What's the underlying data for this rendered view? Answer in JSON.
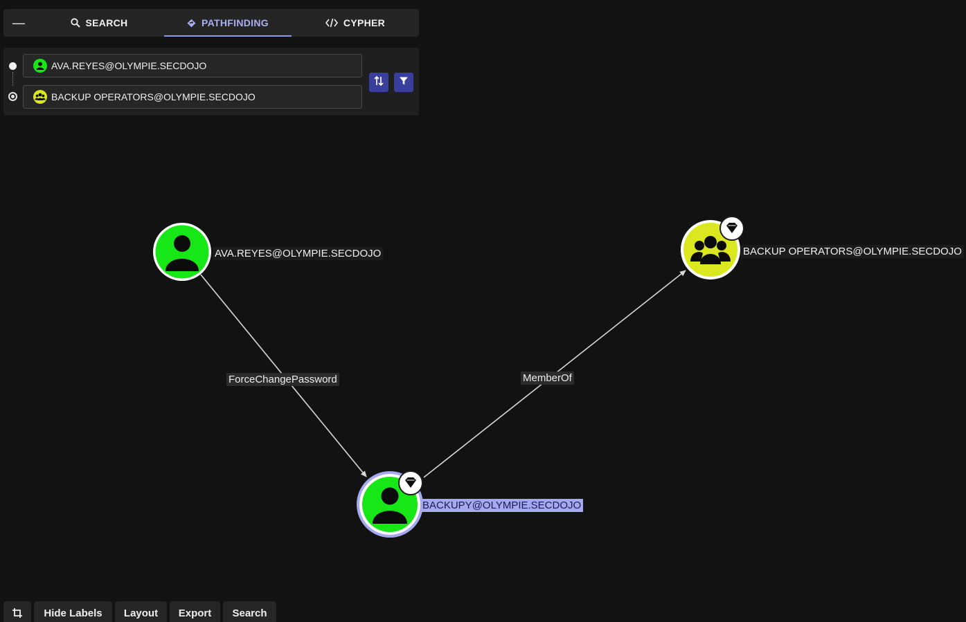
{
  "tabs": {
    "collapse_label": "—",
    "search_label": "SEARCH",
    "pathfinding_label": "PATHFINDING",
    "cypher_label": "CYPHER",
    "active": "pathfinding"
  },
  "pathfinding": {
    "start_value": "AVA.REYES@OLYMPIE.SECDOJO",
    "end_value": "BACKUP OPERATORS@OLYMPIE.SECDOJO",
    "start_icon": "user-icon",
    "end_icon": "group-icon"
  },
  "graph": {
    "nodes": [
      {
        "id": "ava",
        "label": "AVA.REYES@OLYMPIE.SECDOJO",
        "type": "user",
        "color": "#17e617",
        "tier_zero": false,
        "selected": false
      },
      {
        "id": "backupy",
        "label": "BACKUPY@OLYMPIE.SECDOJO",
        "type": "user",
        "color": "#17e617",
        "tier_zero": true,
        "selected": true
      },
      {
        "id": "backupops",
        "label": "BACKUP OPERATORS@OLYMPIE.SECDOJO",
        "type": "group",
        "color": "#dce81f",
        "tier_zero": true,
        "selected": false
      }
    ],
    "edges": [
      {
        "from": "ava",
        "to": "backupy",
        "label": "ForceChangePassword"
      },
      {
        "from": "backupy",
        "to": "backupops",
        "label": "MemberOf"
      }
    ]
  },
  "toolbar": {
    "crop_icon": "crop-icon",
    "hide_labels": "Hide Labels",
    "layout": "Layout",
    "export": "Export",
    "search": "Search"
  },
  "colors": {
    "accent": "#8f98ea",
    "user_node": "#17e617",
    "group_node": "#dce81f",
    "selected_ring": "#a5aaf0"
  }
}
